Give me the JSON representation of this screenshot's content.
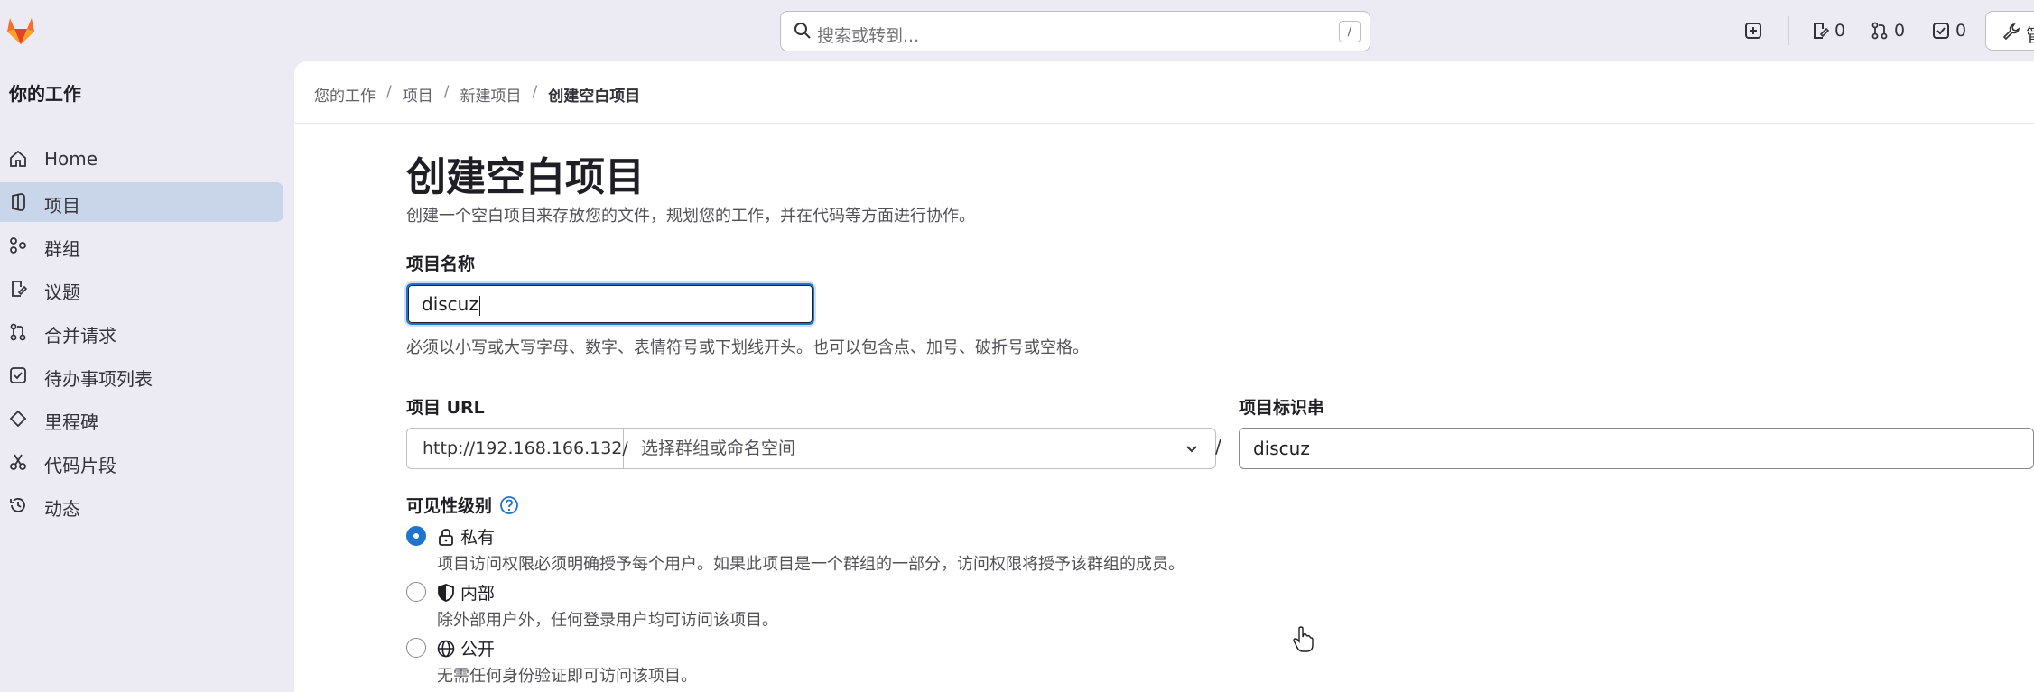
{
  "topbar": {
    "search_placeholder": "搜索或转到...",
    "search_shortcut": "/",
    "issues_count": "0",
    "mr_count": "0",
    "todos_count": "0",
    "admin_label": "管"
  },
  "sidebar": {
    "title": "你的工作",
    "items": [
      {
        "label": "Home",
        "icon": "home-icon"
      },
      {
        "label": "项目",
        "icon": "project-icon"
      },
      {
        "label": "群组",
        "icon": "group-icon"
      },
      {
        "label": "议题",
        "icon": "issues-icon"
      },
      {
        "label": "合并请求",
        "icon": "merge-request-icon"
      },
      {
        "label": "待办事项列表",
        "icon": "todo-icon"
      },
      {
        "label": "里程碑",
        "icon": "milestone-icon"
      },
      {
        "label": "代码片段",
        "icon": "snippet-icon"
      },
      {
        "label": "动态",
        "icon": "activity-icon"
      }
    ],
    "active_index": 1
  },
  "breadcrumb": [
    "您的工作",
    "项目",
    "新建项目",
    "创建空白项目"
  ],
  "page": {
    "title": "创建空白项目",
    "description": "创建一个空白项目来存放您的文件，规划您的工作，并在代码等方面进行协作。"
  },
  "form": {
    "name_label": "项目名称",
    "name_value": "discuz",
    "name_hint": "必须以小写或大写字母、数字、表情符号或下划线开头。也可以包含点、加号、破折号或空格。",
    "url_label": "项目 URL",
    "url_prefix": "http://192.168.166.132/",
    "namespace_placeholder": "选择群组或命名空间",
    "url_separator": "/",
    "slug_label": "项目标识串",
    "slug_value": "discuz",
    "visibility_label": "可见性级别",
    "visibility_options": [
      {
        "label": "私有",
        "description": "项目访问权限必须明确授予每个用户。如果此项目是一个群组的一部分，访问权限将授予该群组的成员。",
        "checked": true
      },
      {
        "label": "内部",
        "description": "除外部用户外，任何登录用户均可访问该项目。",
        "checked": false
      },
      {
        "label": "公开",
        "description": "无需任何身份验证即可访问该项目。",
        "checked": false
      }
    ]
  },
  "colors": {
    "accent": "#1f75cb",
    "sidebar_active": "#c9d6e9",
    "background": "#ecebf3"
  }
}
